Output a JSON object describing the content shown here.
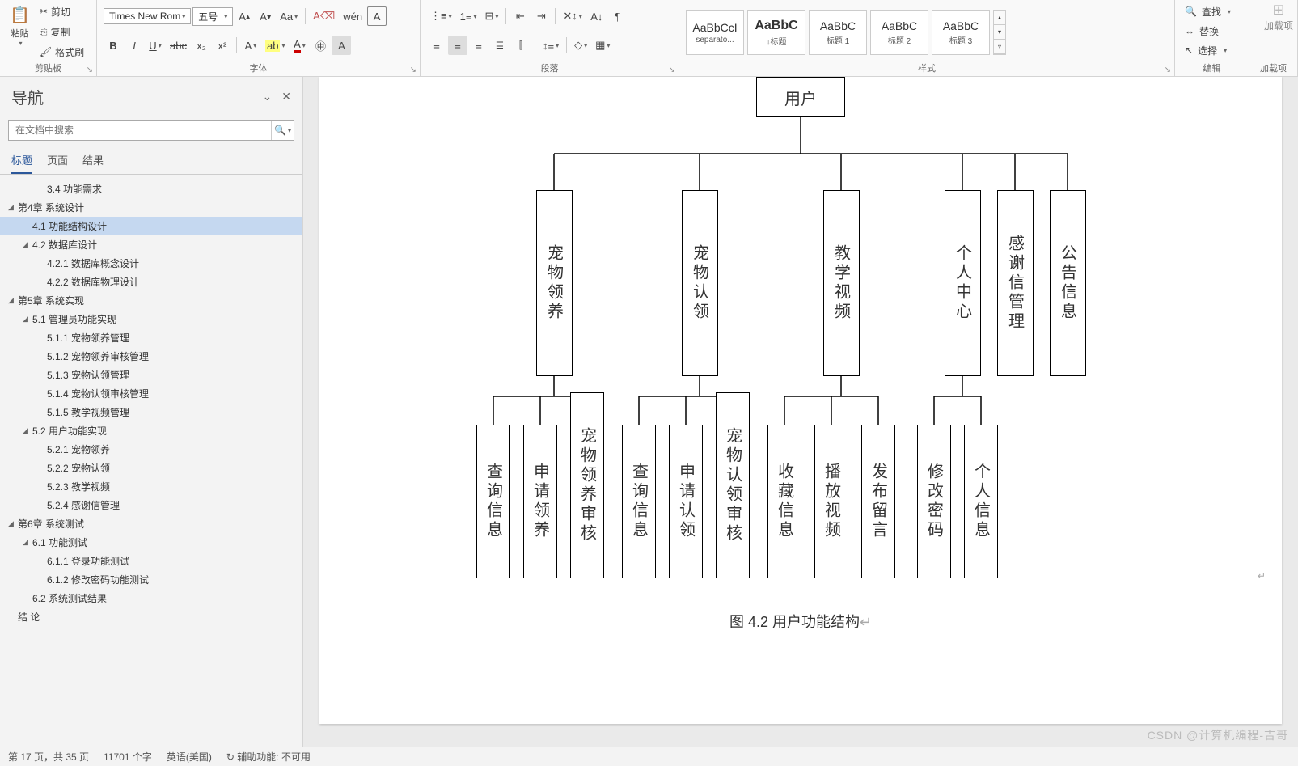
{
  "ribbon": {
    "clipboard": {
      "paste": "粘贴",
      "cut": "剪切",
      "copy": "复制",
      "format_painter": "格式刷",
      "label": "剪贴板"
    },
    "font": {
      "name": "Times New Rom",
      "size": "五号",
      "label": "字体",
      "bold": "B",
      "italic": "I",
      "underline": "U",
      "strike": "abc",
      "sub": "x₂",
      "sup": "x²",
      "phonetic": "wén",
      "textbox": "A"
    },
    "paragraph": {
      "label": "段落"
    },
    "styles": {
      "label": "样式",
      "items": [
        {
          "preview": "AaBbCcI",
          "name": "separato...",
          "bold": false
        },
        {
          "preview": "AaBbC",
          "name": "↓标题",
          "bold": true
        },
        {
          "preview": "AaBbC",
          "name": "标题 1",
          "bold": false
        },
        {
          "preview": "AaBbC",
          "name": "标题 2",
          "bold": false
        },
        {
          "preview": "AaBbC",
          "name": "标题 3",
          "bold": false
        }
      ]
    },
    "editing": {
      "find": "查找",
      "replace": "替换",
      "select": "选择",
      "label": "编辑"
    },
    "addins": {
      "label": "加载项",
      "text": "加载项"
    }
  },
  "nav": {
    "title": "导航",
    "search_placeholder": "在文档中搜索",
    "tabs": {
      "headings": "标题",
      "pages": "页面",
      "results": "结果"
    },
    "tree": [
      {
        "lv": 2,
        "txt": "3.4 功能需求"
      },
      {
        "lv": 0,
        "txt": "第4章 系统设计",
        "arrow": "▲"
      },
      {
        "lv": 1,
        "txt": "4.1 功能结构设计",
        "sel": true
      },
      {
        "lv": 1,
        "txt": "4.2 数据库设计",
        "arrow": "▲"
      },
      {
        "lv": 2,
        "txt": "4.2.1 数据库概念设计"
      },
      {
        "lv": 2,
        "txt": "4.2.2 数据库物理设计"
      },
      {
        "lv": 0,
        "txt": "第5章 系统实现",
        "arrow": "▲"
      },
      {
        "lv": 1,
        "txt": "5.1 管理员功能实现",
        "arrow": "▲"
      },
      {
        "lv": 2,
        "txt": "5.1.1 宠物领养管理"
      },
      {
        "lv": 2,
        "txt": "5.1.2 宠物领养审核管理"
      },
      {
        "lv": 2,
        "txt": "5.1.3 宠物认领管理"
      },
      {
        "lv": 2,
        "txt": "5.1.4 宠物认领审核管理"
      },
      {
        "lv": 2,
        "txt": "5.1.5 教学视频管理"
      },
      {
        "lv": 1,
        "txt": "5.2 用户功能实现",
        "arrow": "▲"
      },
      {
        "lv": 2,
        "txt": "5.2.1 宠物领养"
      },
      {
        "lv": 2,
        "txt": "5.2.2 宠物认领"
      },
      {
        "lv": 2,
        "txt": "5.2.3 教学视频"
      },
      {
        "lv": 2,
        "txt": "5.2.4 感谢信管理"
      },
      {
        "lv": 0,
        "txt": "第6章 系统测试",
        "arrow": "▲"
      },
      {
        "lv": 1,
        "txt": "6.1 功能测试",
        "arrow": "▲"
      },
      {
        "lv": 2,
        "txt": "6.1.1 登录功能测试"
      },
      {
        "lv": 2,
        "txt": "6.1.2 修改密码功能测试"
      },
      {
        "lv": 1,
        "txt": "6.2 系统测试结果"
      },
      {
        "lv": 0,
        "txt": "结  论"
      }
    ]
  },
  "chart_data": {
    "type": "tree",
    "title": "图 4.2  用户功能结构",
    "root": "用户",
    "children": [
      {
        "name": "宠物领养",
        "children": [
          "查询信息",
          "申请领养",
          "宠物领养审核"
        ]
      },
      {
        "name": "宠物认领",
        "children": [
          "查询信息",
          "申请认领",
          "宠物认领审核"
        ]
      },
      {
        "name": "教学视频",
        "children": [
          "收藏信息",
          "播放视频",
          "发布留言"
        ]
      },
      {
        "name": "个人中心",
        "children": [
          "修改密码",
          "个人信息"
        ]
      },
      {
        "name": "感谢信管理",
        "children": []
      },
      {
        "name": "公告信息",
        "children": []
      }
    ]
  },
  "status": {
    "page": "第 17 页，共 35 页",
    "words": "11701 个字",
    "lang": "英语(美国)",
    "accessibility": "辅助功能: 不可用"
  },
  "watermark": "CSDN @计算机编程-吉哥"
}
